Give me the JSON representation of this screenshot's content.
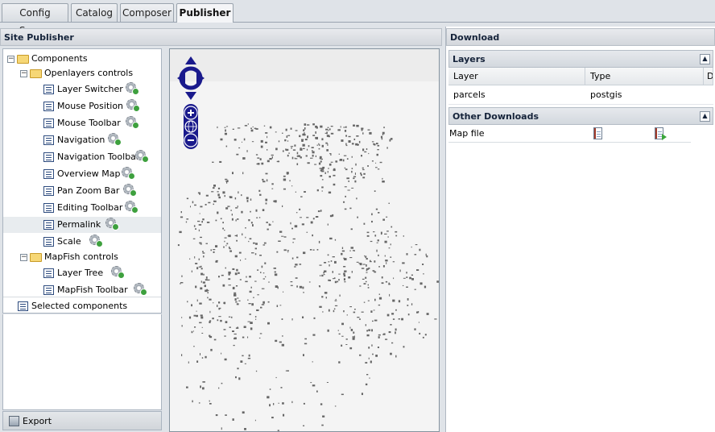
{
  "tabs": [
    {
      "label": "Config Server",
      "active": false
    },
    {
      "label": "Catalog",
      "active": false
    },
    {
      "label": "Composer",
      "active": false
    },
    {
      "label": "Publisher",
      "active": true
    }
  ],
  "site_publisher": {
    "title": "Site Publisher",
    "tree": {
      "root": "Components",
      "groups": [
        {
          "label": "Openlayers controls",
          "items": [
            "Layer Switcher",
            "Mouse Position",
            "Mouse Toolbar",
            "Navigation",
            "Navigation Toolbar",
            "Overview Map",
            "Pan Zoom Bar",
            "Editing Toolbar",
            "Permalink",
            "Scale"
          ]
        },
        {
          "label": "MapFish controls",
          "items": [
            "Layer Tree",
            "MapFish Toolbar"
          ]
        }
      ],
      "selected": "Selected components",
      "highlighted": "Permalink"
    },
    "export_label": "Export"
  },
  "map": {
    "controls": [
      "pan-north",
      "pan-west",
      "pan-east",
      "pan-south",
      "zoom-in",
      "zoom-world",
      "zoom-out"
    ]
  },
  "download": {
    "title": "Download",
    "layers": {
      "title": "Layers",
      "columns": [
        "Layer",
        "Type",
        "D"
      ],
      "rows": [
        [
          "parcels",
          "postgis"
        ]
      ]
    },
    "other": {
      "title": "Other Downloads",
      "rows": [
        {
          "label": "Map file"
        }
      ]
    }
  },
  "colors": {
    "map_control": "#1a1a8c",
    "features": "#555555",
    "header_text": "#15233a"
  }
}
